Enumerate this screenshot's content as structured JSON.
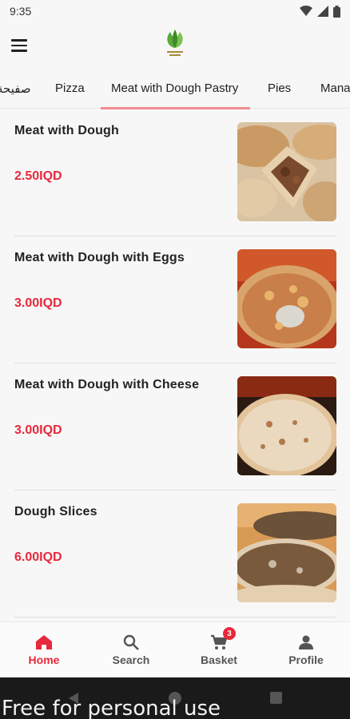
{
  "status_bar": {
    "time": "9:35"
  },
  "tabs": [
    {
      "label": "صفيحة"
    },
    {
      "label": "Pizza"
    },
    {
      "label": "Meat with Dough Pastry"
    },
    {
      "label": "Pies"
    },
    {
      "label": "Mana"
    }
  ],
  "active_tab": "Meat with Dough Pastry",
  "items": [
    {
      "name": "Meat with Dough",
      "price": "2.50IQD"
    },
    {
      "name": "Meat with Dough with Eggs",
      "price": "3.00IQD"
    },
    {
      "name": "Meat with Dough with Cheese",
      "price": "3.00IQD"
    },
    {
      "name": "Dough Slices",
      "price": "6.00IQD"
    }
  ],
  "bottom_nav": {
    "home": "Home",
    "search": "Search",
    "basket": "Basket",
    "basket_count": "3",
    "profile": "Profile"
  },
  "watermark": "Free for personal use",
  "colors": {
    "accent": "#e8283b",
    "tab_underline": "#f28b93"
  }
}
